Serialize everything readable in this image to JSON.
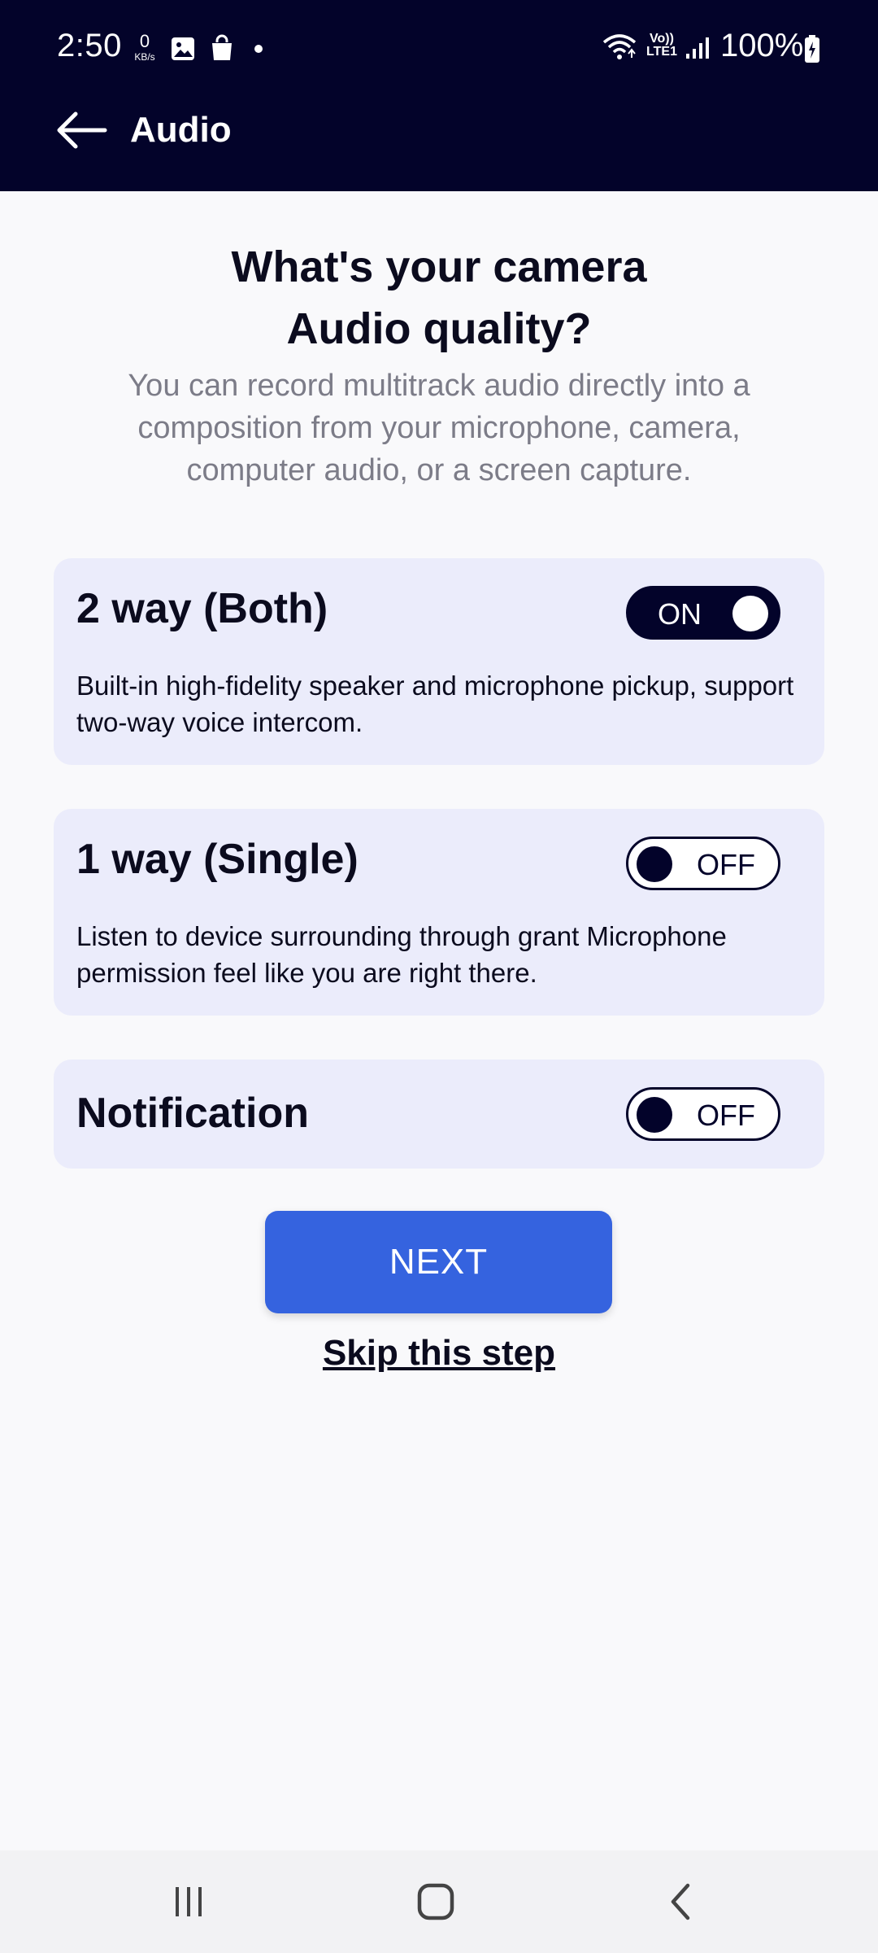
{
  "status_bar": {
    "time": "2:50",
    "net_speed_value": "0",
    "net_speed_unit": "KB/s",
    "network_label_top": "Vo))",
    "network_label_bottom": "LTE1",
    "battery": "100%",
    "icons": [
      "gallery-icon",
      "shopping-bag-icon",
      "wifi-icon",
      "signal-icon",
      "battery-charging-icon"
    ]
  },
  "app_bar": {
    "title": "Audio",
    "back_icon": "arrow-left-icon"
  },
  "main": {
    "headline_line1": "What's your camera",
    "headline_line2": "Audio quality?",
    "description": "You can record multitrack audio directly into a composition from your microphone, camera, computer audio, or a screen capture.",
    "options": [
      {
        "title": "2 way (Both)",
        "description": "Built-in high-fidelity speaker and microphone pickup, support two-way voice intercom.",
        "toggle_label": "ON",
        "enabled": true
      },
      {
        "title": "1 way (Single)",
        "description": "Listen to device surrounding through grant Microphone permission feel like you are right there.",
        "toggle_label": "OFF",
        "enabled": false
      },
      {
        "title": "Notification",
        "toggle_label": "OFF",
        "enabled": false
      }
    ],
    "next_label": "NEXT",
    "skip_label": "Skip this step"
  },
  "nav_bar": {
    "items": [
      "recent-apps-icon",
      "home-icon",
      "back-icon"
    ]
  },
  "colors": {
    "header_bg": "#03032a",
    "card_bg": "#ebecfb",
    "primary_button": "#3563df",
    "page_bg": "#f9f9fb",
    "muted_text": "#7c7c88"
  }
}
